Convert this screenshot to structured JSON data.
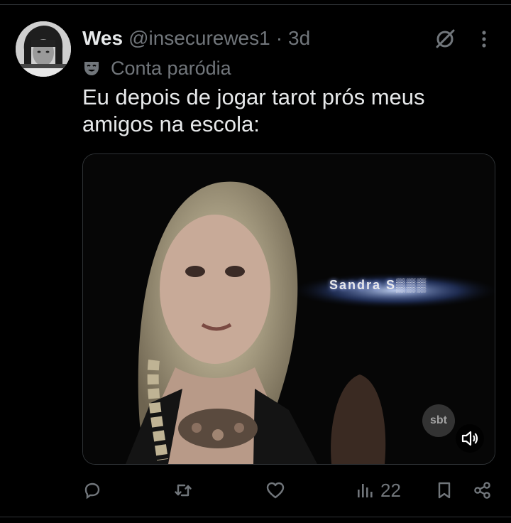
{
  "tweet": {
    "display_name": "Wes",
    "handle": "@insecurewes1",
    "separator": "·",
    "time": "3d",
    "parody_label": "Conta paródia",
    "text": "Eu depois de jogar tarot prós meus amigos na escola:"
  },
  "media": {
    "caption": "Sandra S▒▒▒",
    "watermark": "sbt"
  },
  "actions": {
    "views": "22"
  },
  "icons": [
    "grok-icon",
    "more-icon",
    "parody-mask-icon",
    "mute-icon",
    "reply-icon",
    "retweet-icon",
    "like-icon",
    "views-icon",
    "bookmark-icon",
    "share-icon"
  ],
  "colors": {
    "background": "#000000",
    "text": "#e7e9ea",
    "muted": "#71767b",
    "divider": "#2f3336"
  }
}
